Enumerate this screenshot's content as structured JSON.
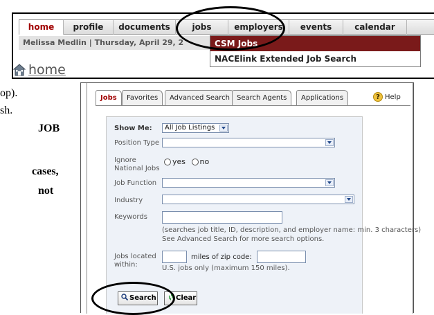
{
  "background_text": {
    "line1": "op).",
    "line2": "sh.",
    "line3": "JOB",
    "line4": "cases,",
    "line5": "not"
  },
  "nav": {
    "items": [
      {
        "label": "home",
        "active": true
      },
      {
        "label": "profile"
      },
      {
        "label": "documents"
      },
      {
        "label": "jobs"
      },
      {
        "label": "employers"
      },
      {
        "label": "events"
      },
      {
        "label": "calendar"
      }
    ]
  },
  "status": {
    "text": "Melissa Medlin | Thursday, April 29, 2"
  },
  "jobs_dropdown": {
    "item1": "CSM Jobs",
    "item2": "NACElink Extended Job Search"
  },
  "page_title": "home",
  "tabs": [
    "Jobs",
    "Favorites",
    "Advanced Search",
    "Search Agents",
    "Applications"
  ],
  "help_label": "Help",
  "form": {
    "show_me_label": "Show Me:",
    "show_me_value": "All Job Listings",
    "position_type_label": "Position Type",
    "ignore_label_1": "Ignore",
    "ignore_label_2": "National Jobs",
    "yes_label": "yes",
    "no_label": "no",
    "job_function_label": "Job Function",
    "industry_label": "Industry",
    "keywords_label": "Keywords",
    "keywords_hint_1": "(searches job title, ID, description, and employer name: min. 3 characters)",
    "keywords_hint_2": "See Advanced Search for more search options.",
    "jobs_located_1": "Jobs located",
    "jobs_located_2": "within:",
    "miles_label": "miles of zip code:",
    "location_hint": "U.S. jobs only (maximum 150 miles).",
    "search_button": "Search",
    "clear_button": "Clear"
  },
  "colors": {
    "active_tab": "#a00000",
    "dropdown_highlight": "#7a1a1a",
    "form_bg": "#eef2f8"
  }
}
